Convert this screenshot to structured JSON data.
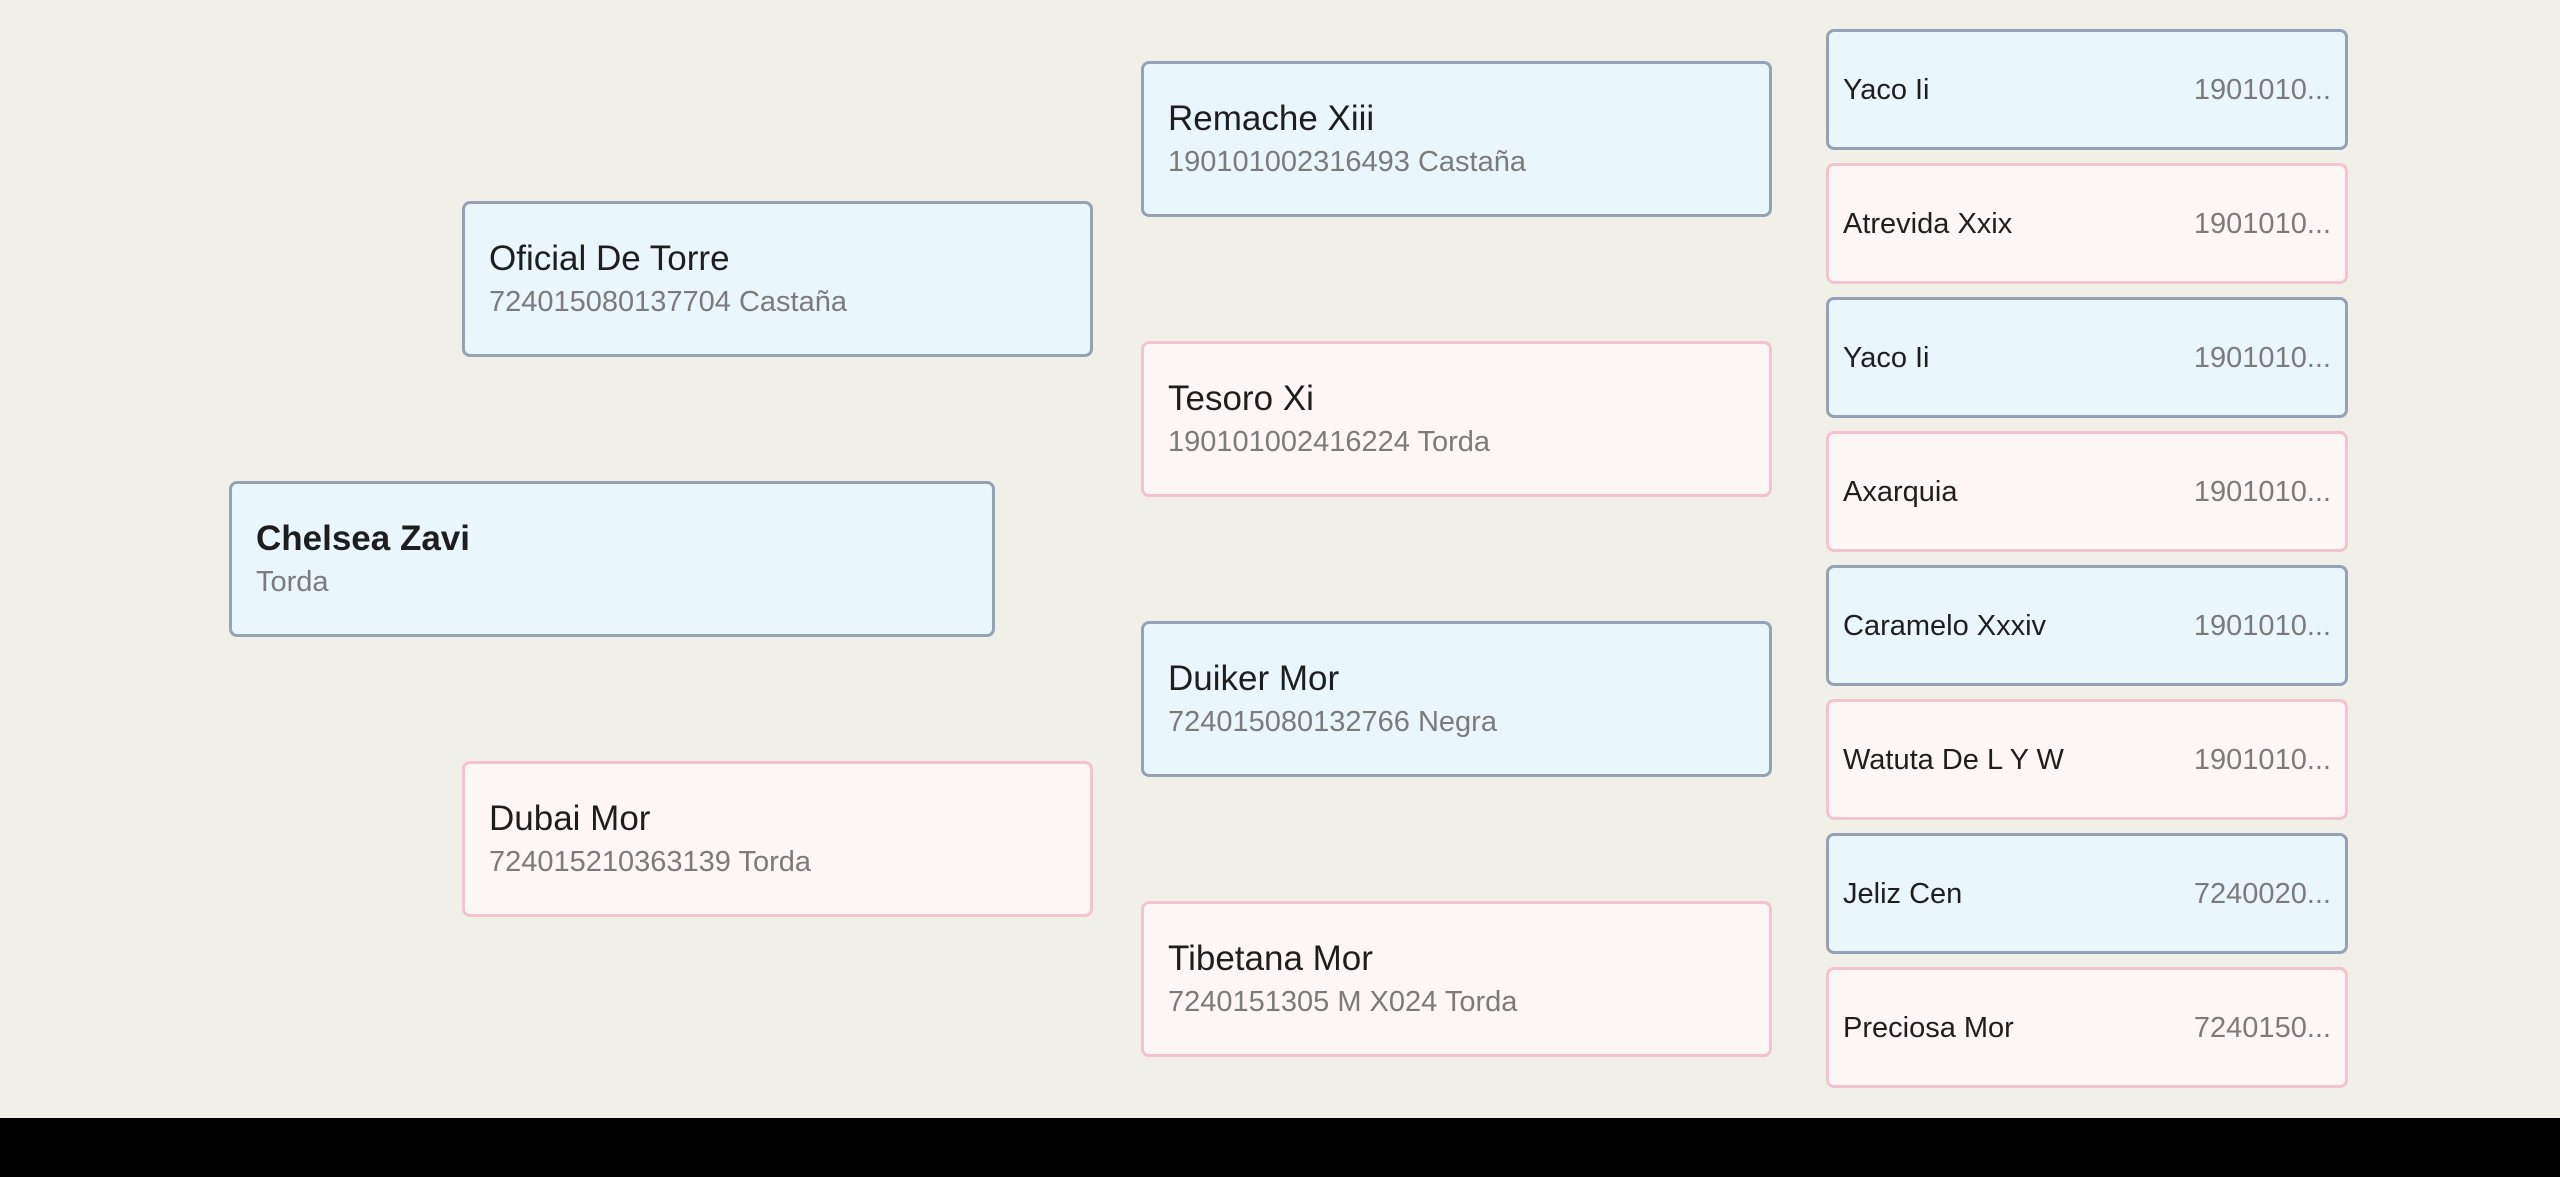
{
  "root": {
    "name": "Chelsea Zavi",
    "sub": "Torda"
  },
  "parents": [
    {
      "name": "Oficial De Torre",
      "sub": "724015080137704 Castaña",
      "sex": "male"
    },
    {
      "name": "Dubai Mor",
      "sub": "724015210363139 Torda",
      "sex": "female"
    }
  ],
  "grandparents": [
    {
      "name": "Remache Xiii",
      "sub": "190101002316493 Castaña",
      "sex": "male"
    },
    {
      "name": "Tesoro Xi",
      "sub": "190101002416224 Torda",
      "sex": "female"
    },
    {
      "name": "Duiker Mor",
      "sub": "724015080132766 Negra",
      "sex": "male"
    },
    {
      "name": "Tibetana Mor",
      "sub": "7240151305 M X024 Torda",
      "sex": "female"
    }
  ],
  "great_grandparents": [
    {
      "name": "Yaco Ii",
      "sub": "1901010...",
      "sex": "male"
    },
    {
      "name": "Atrevida Xxix",
      "sub": "1901010...",
      "sex": "female"
    },
    {
      "name": "Yaco Ii",
      "sub": "1901010...",
      "sex": "male"
    },
    {
      "name": "Axarquia",
      "sub": "1901010...",
      "sex": "female"
    },
    {
      "name": "Caramelo Xxxiv",
      "sub": "1901010...",
      "sex": "male"
    },
    {
      "name": "Watuta De L Y W",
      "sub": "1901010...",
      "sex": "female"
    },
    {
      "name": "Jeliz Cen",
      "sub": "7240020...",
      "sex": "male"
    },
    {
      "name": "Preciosa Mor",
      "sub": "7240150...",
      "sex": "female"
    }
  ]
}
